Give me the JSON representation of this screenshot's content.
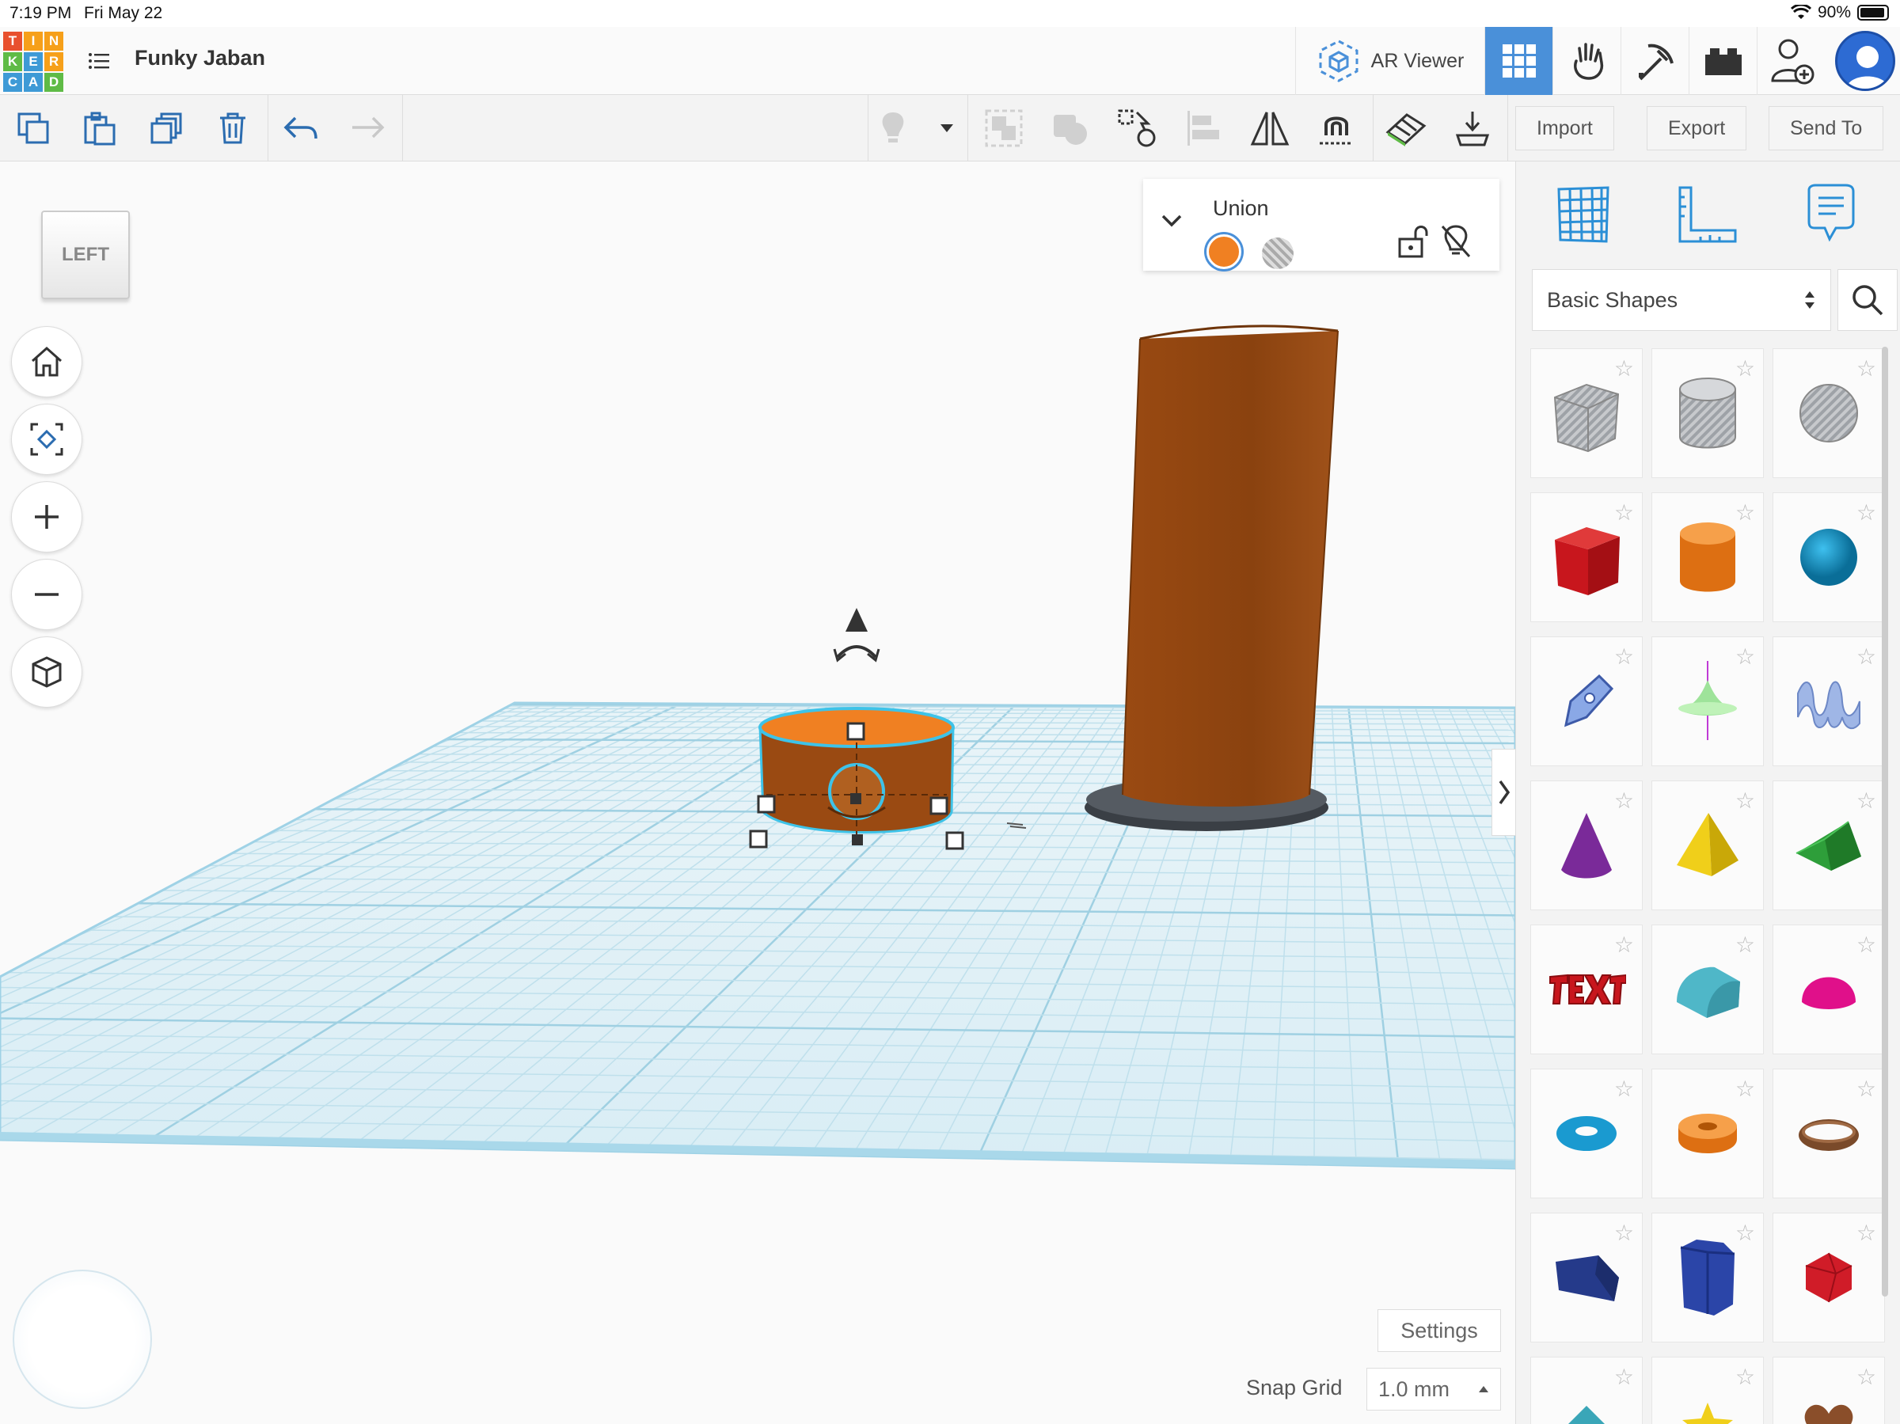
{
  "status": {
    "time": "7:19 PM",
    "date": "Fri May 22",
    "battery": "90%"
  },
  "logo": {
    "letters": [
      "T",
      "I",
      "N",
      "K",
      "E",
      "R",
      "C",
      "A",
      "D"
    ]
  },
  "header": {
    "project_title": "Funky Jaban",
    "ar_viewer": "AR Viewer"
  },
  "toolbar": {
    "import": "Import",
    "export": "Export",
    "send_to": "Send To"
  },
  "viewcube": {
    "face": "LEFT"
  },
  "inspector": {
    "title": "Union"
  },
  "shapes": {
    "category": "Basic Shapes"
  },
  "workplane": {
    "settings": "Settings",
    "snap_grid_label": "Snap Grid",
    "snap_grid_value": "1.0 mm"
  },
  "colors": {
    "accent": "#4a90d9",
    "orange": "#f08022",
    "grid": "#cfe8f3"
  }
}
